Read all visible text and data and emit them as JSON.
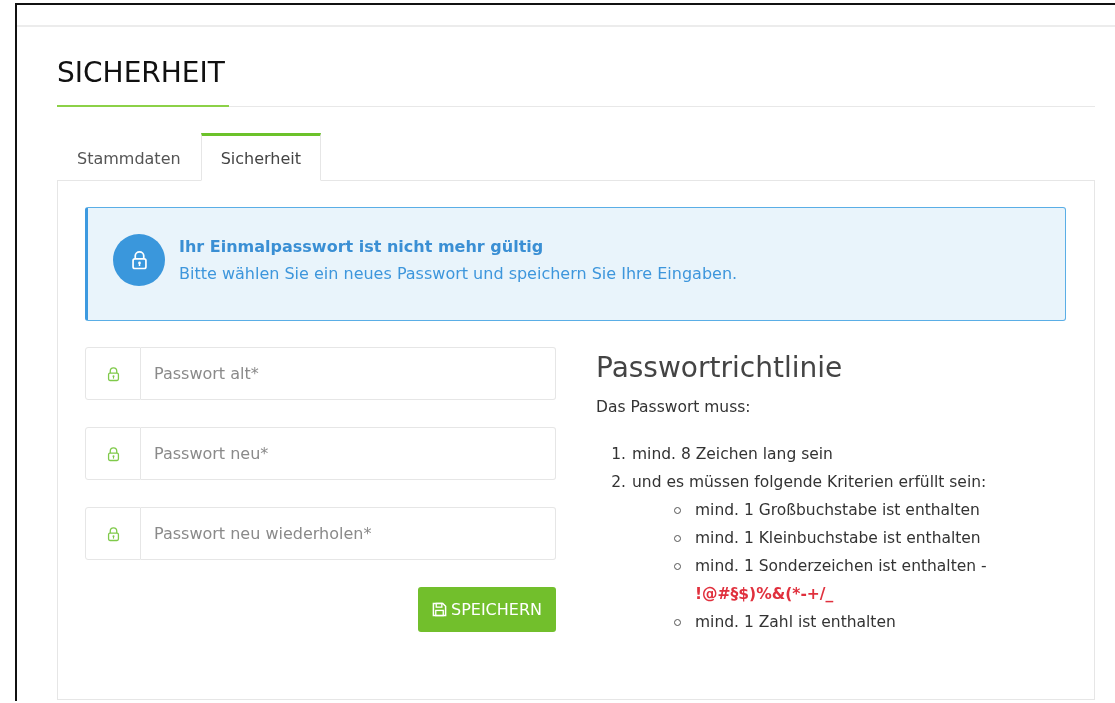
{
  "heading": "SICHERHEIT",
  "tabs": [
    {
      "label": "Stammdaten",
      "selected": false
    },
    {
      "label": "Sicherheit",
      "selected": true
    }
  ],
  "alert": {
    "title": "Ihr Einmalpasswort ist nicht mehr gültig",
    "message": "Bitte wählen Sie ein neues Passwort und speichern Sie Ihre Eingaben."
  },
  "fields": [
    {
      "placeholder": "Passwort alt*"
    },
    {
      "placeholder": "Passwort neu*"
    },
    {
      "placeholder": "Passwort neu wiederholen*"
    }
  ],
  "save_button": "SPEICHERN",
  "policy": {
    "title": "Passwortrichtlinie",
    "intro": "Das Passwort muss:",
    "rules": [
      {
        "number": "1.",
        "text": "mind. 8 Zeichen lang sein"
      },
      {
        "number": "2.",
        "text": "und es müssen folgende Kriterien erfüllt sein:",
        "children": [
          {
            "text": "mind. 1 Großbuchstabe ist enthalten"
          },
          {
            "text": "mind. 1 Kleinbuchstabe ist enthalten"
          },
          {
            "text": "mind. 1 Sonderzeichen ist enthalten - **!@#§$)%&(*-+/_**"
          },
          {
            "text": "mind. 1 Zahl ist enthalten"
          }
        ]
      }
    ]
  }
}
